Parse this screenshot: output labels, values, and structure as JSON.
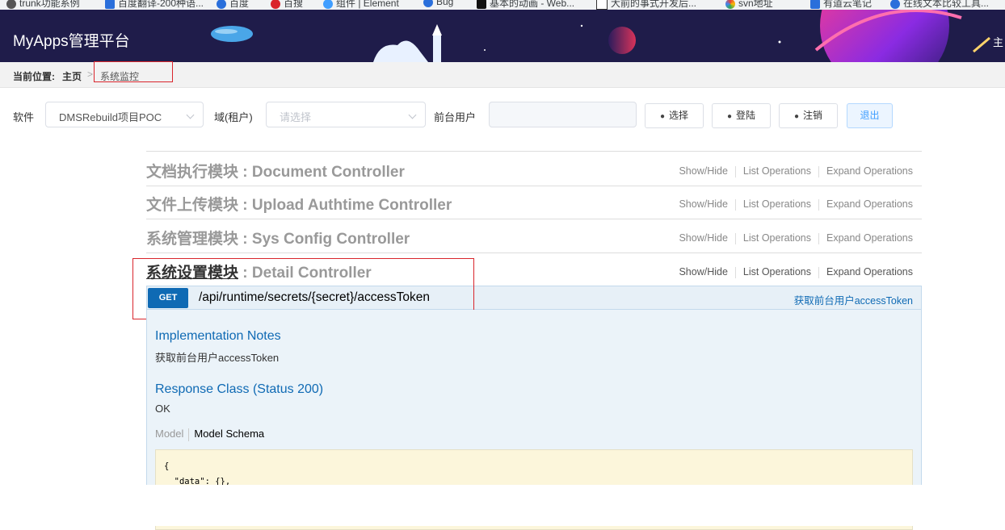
{
  "bookmarks": [
    {
      "label": "trunk功能系例",
      "color": "#555"
    },
    {
      "label": "百度翻译-200种语...",
      "color": "#2a6fdb"
    },
    {
      "label": "百度",
      "color": "#2a6fdb"
    },
    {
      "label": "百搜",
      "color": "#d9252c"
    },
    {
      "label": "组件 | Element",
      "color": "#409eff"
    },
    {
      "label": "Bug",
      "color": "#2a6fdb"
    },
    {
      "label": "基本的动画 - Web...",
      "color": "#111"
    },
    {
      "label": "大前的事式开发后...",
      "color": "#333"
    },
    {
      "label": "svn地址",
      "color": "#e0a100"
    },
    {
      "label": "有道云笔记",
      "color": "#2a6fdb"
    },
    {
      "label": "在线文本比较工具...",
      "color": "#2a6fdb"
    }
  ],
  "header": {
    "title": "MyApps管理平台",
    "user": "主"
  },
  "breadcrumb": {
    "label": "当前位置:",
    "home": "主页",
    "separator": ">",
    "current": "系统监控"
  },
  "filters": {
    "software_label": "软件",
    "software_value": "DMSRebuild项目POC",
    "domain_label": "域(租户)",
    "domain_placeholder": "请选择",
    "user_label": "前台用户",
    "user_value": "",
    "buttons": {
      "select": "选择",
      "login": "登陆",
      "logout": "注销",
      "exit": "退出"
    }
  },
  "sections": [
    {
      "cn": "文档执行模块",
      "en": " : Document Controller"
    },
    {
      "cn": "文件上传模块",
      "en": " : Upload Authtime Controller"
    },
    {
      "cn": "系统管理模块",
      "en": " : Sys Config Controller"
    },
    {
      "cn": "系统设置模块",
      "en": " : Detail Controller"
    }
  ],
  "section_ops": {
    "show_hide": "Show/Hide",
    "list": "List Operations",
    "expand": "Expand Operations"
  },
  "operation": {
    "method": "GET",
    "path": "/api/runtime/secrets/{secret}/accessToken",
    "summary": "获取前台用户accessToken",
    "impl_title": "Implementation Notes",
    "impl_text": "获取前台用户accessToken",
    "response_title": "Response Class (Status 200)",
    "response_text": "OK",
    "model_tab": "Model",
    "schema_tab": "Model Schema",
    "code_lines": [
      "{",
      "  \"data\": {},"
    ]
  },
  "colors": {
    "header_bg": "#1f1c4a",
    "method_bg": "#0f6ab4",
    "highlight_box": "#d9252c"
  }
}
